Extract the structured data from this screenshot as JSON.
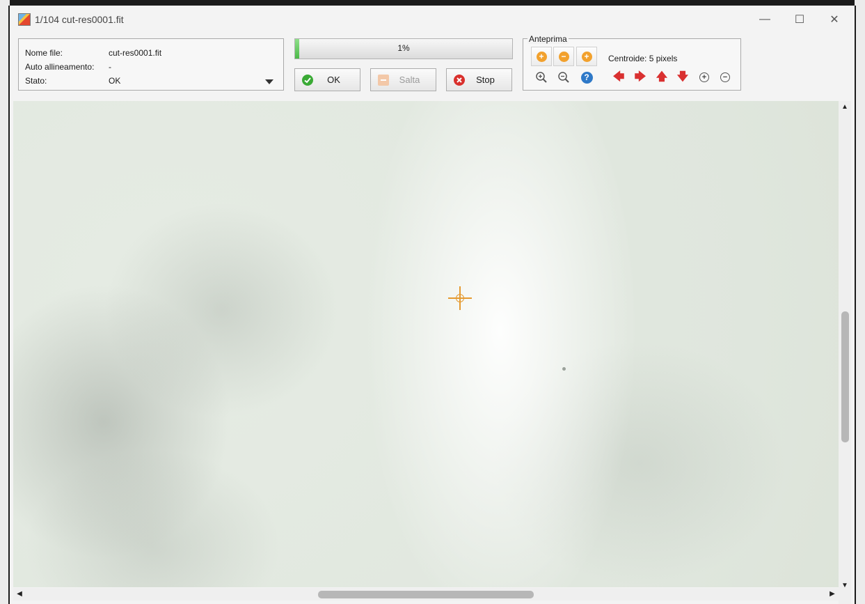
{
  "window": {
    "title": "1/104  cut-res0001.fit",
    "controls": {
      "minimize": "—",
      "maximize": "☐",
      "close": "✕"
    }
  },
  "info": {
    "file_label": "Nome file:",
    "file_value": "cut-res0001.fit",
    "align_label": "Auto allineamento:",
    "align_value": "-",
    "state_label": "Stato:",
    "state_value": "OK"
  },
  "progress": {
    "value": 0.01,
    "text": "1%"
  },
  "buttons": {
    "ok": "OK",
    "skip": "Salta",
    "stop": "Stop"
  },
  "preview": {
    "legend": "Anteprima",
    "centroid": "Centroide: 5 pixels",
    "icons": [
      "plus-icon",
      "minus-icon",
      "plus-icon",
      "zoom-in-icon",
      "zoom-out-icon",
      "help-icon",
      "arrow-left-icon",
      "arrow-right-icon",
      "arrow-up-icon",
      "arrow-down-icon",
      "circle-plus-icon",
      "circle-minus-icon"
    ]
  },
  "colors": {
    "accent_orange": "#f2a12d",
    "help_blue": "#2f79c8",
    "arrow_red": "#d93030",
    "ok_green": "#3aaa35",
    "stop_red": "#d9302c",
    "crosshair": "#e59a30"
  },
  "scroll": {
    "vertical_position": 0.43,
    "horizontal_position": 0.37
  }
}
